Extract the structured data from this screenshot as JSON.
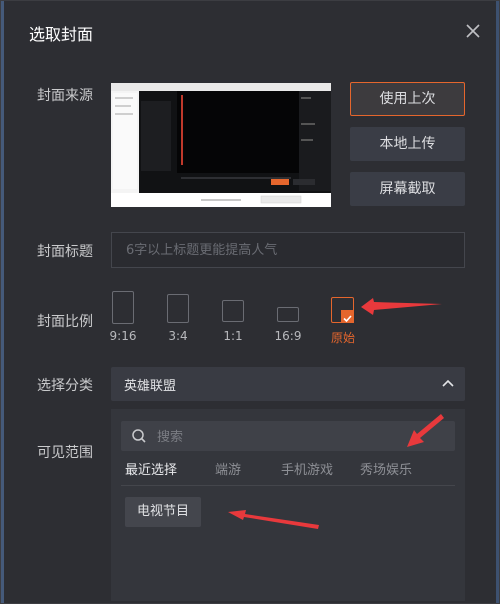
{
  "dialog": {
    "title": "选取封面",
    "close_icon": "close-icon"
  },
  "cover_source": {
    "label": "封面来源",
    "buttons": {
      "use_last": "使用上次",
      "local_upload": "本地上传",
      "screenshot": "屏幕截取"
    }
  },
  "cover_title": {
    "label": "封面标题",
    "placeholder": "6字以上标题更能提高人气",
    "value": ""
  },
  "cover_ratio": {
    "label": "封面比例",
    "options": [
      {
        "label": "9:16"
      },
      {
        "label": "3:4"
      },
      {
        "label": "1:1"
      },
      {
        "label": "16:9"
      },
      {
        "label": "原始"
      }
    ],
    "selected": "原始"
  },
  "category": {
    "label": "选择分类",
    "value": "英雄联盟"
  },
  "visibility": {
    "label": "可见范围",
    "search_placeholder": "搜索",
    "tabs": [
      "最近选择",
      "端游",
      "手机游戏",
      "秀场娱乐"
    ],
    "active_tab": "最近选择",
    "items": [
      "电视节目"
    ]
  },
  "colors": {
    "accent": "#e5662d",
    "annotation_arrow": "#e8393c",
    "background": "#2d2e33"
  }
}
